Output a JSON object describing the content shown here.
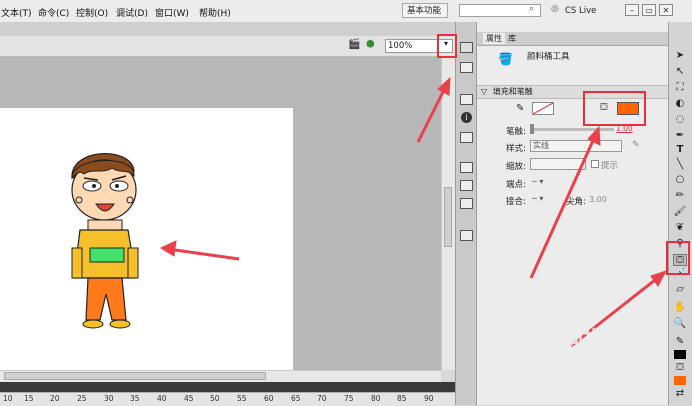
{
  "menu": {
    "items": [
      "文本(T)",
      "命令(C)",
      "控制(O)",
      "调试(D)",
      "窗口(W)",
      "帮助(H)"
    ]
  },
  "workspace": {
    "label": "基本功能 ▾",
    "search_placeholder": "",
    "cs_live": "CS Live"
  },
  "stage": {
    "zoom": "100%"
  },
  "ruler": {
    "ticks": [
      "10",
      "15",
      "20",
      "25",
      "30",
      "35",
      "40",
      "45",
      "50",
      "55",
      "60",
      "65",
      "70",
      "75",
      "80",
      "85",
      "90"
    ]
  },
  "props": {
    "tabs": [
      "属性",
      "库"
    ],
    "tool_name": "颜料桶工具",
    "section_title": "填充和笔触",
    "stroke_label": "笔触:",
    "stroke_value": "1.00",
    "style_label": "样式:",
    "style_value": "实线",
    "scale_label": "缩放:",
    "hint_label": "提示",
    "cap_label": "端点:",
    "join_label": "接合:",
    "miter_label": "尖角:",
    "miter_value": "3.00"
  },
  "colors": {
    "fill": "#ff6600",
    "highlight": "#e8303a",
    "arrow": "#e8414a"
  },
  "watermark": {
    "brand": "搜狗指南",
    "url": "zhinan.sogou.com"
  }
}
